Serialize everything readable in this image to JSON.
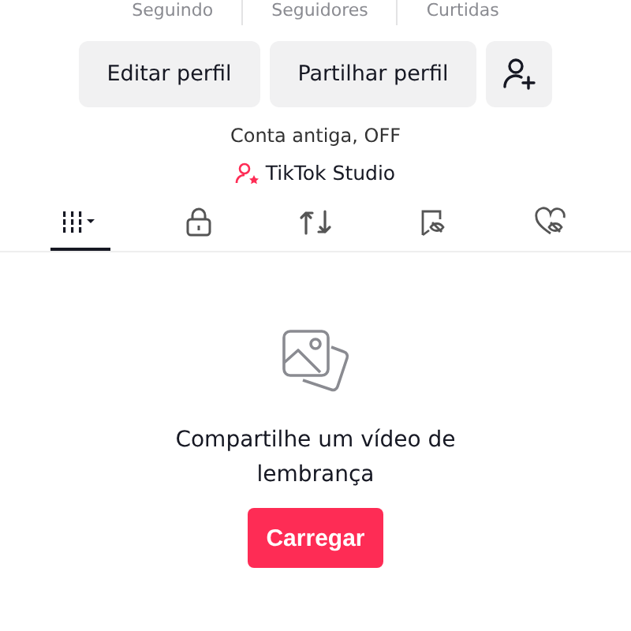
{
  "stats": [
    {
      "label": "Seguindo"
    },
    {
      "label": "Seguidores"
    },
    {
      "label": "Curtidas"
    }
  ],
  "actions": [
    {
      "kind": "text",
      "label": "Editar perfil"
    },
    {
      "kind": "text",
      "label": "Partilhar perfil"
    },
    {
      "kind": "add-friend"
    }
  ],
  "bio": "Conta antiga, OFF",
  "studio_link": "TikTok Studio",
  "tabs": [
    {
      "kind": "grid",
      "selected": true
    },
    {
      "kind": "lock",
      "selected": false
    },
    {
      "kind": "repost",
      "selected": false
    },
    {
      "kind": "bookmark",
      "selected": false
    },
    {
      "kind": "liked",
      "selected": false
    }
  ],
  "empty_state": {
    "message": "Compartilhe um vídeo de lembrança",
    "button": "Carregar"
  }
}
